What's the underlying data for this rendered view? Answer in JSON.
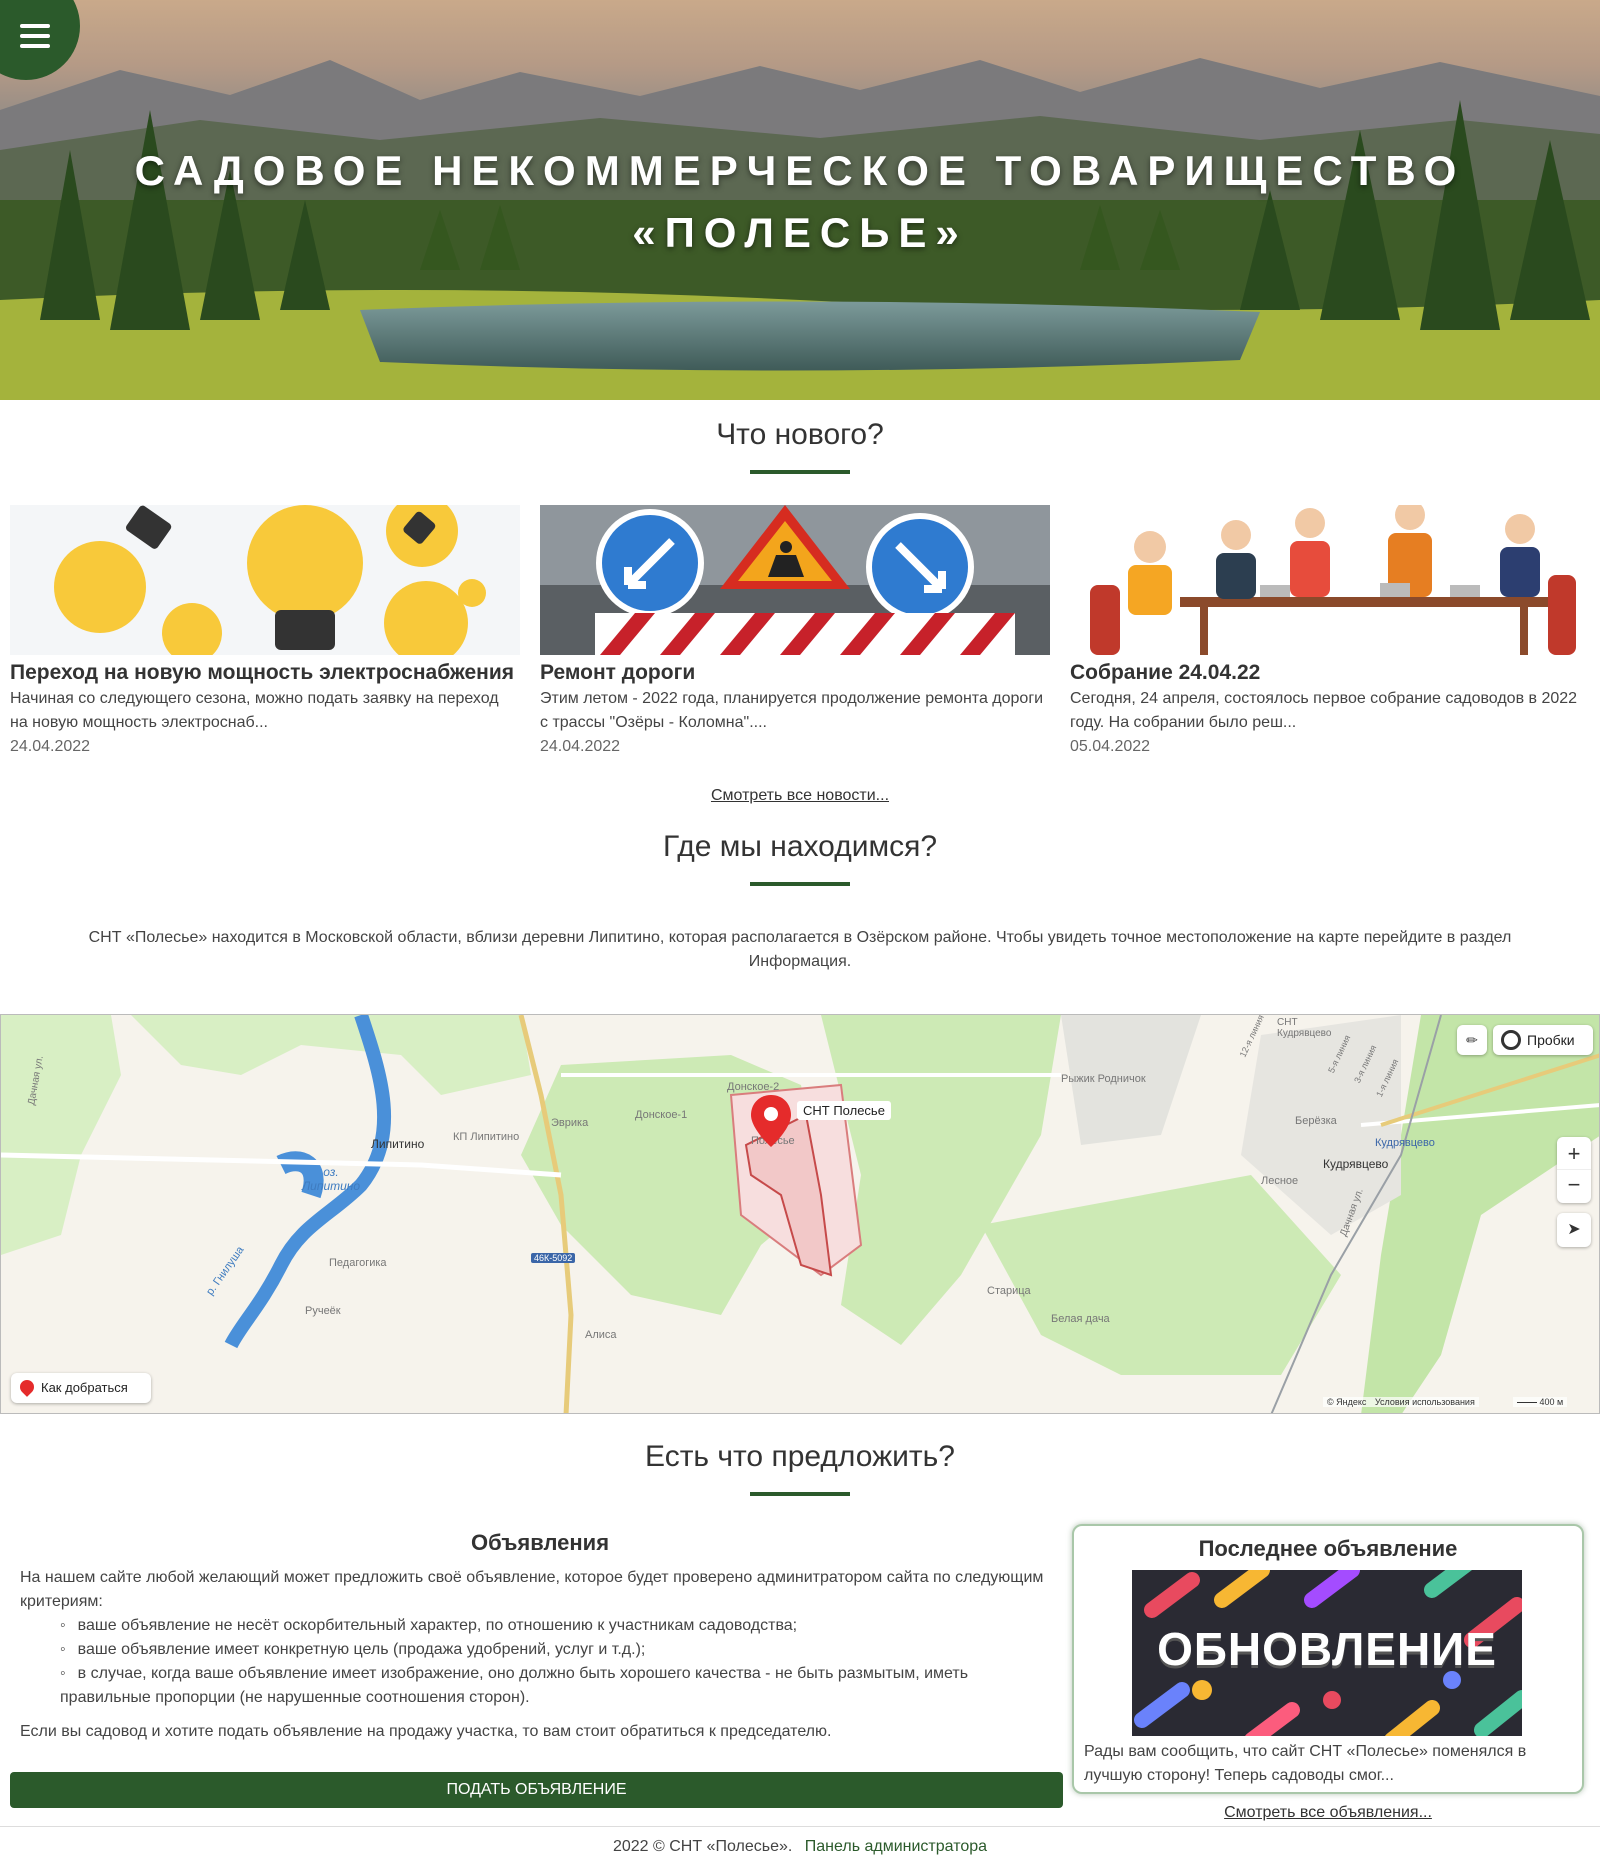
{
  "hero": {
    "title_line1": "САДОВОЕ НЕКОММЕРЧЕСКОЕ ТОВАРИЩЕСТВО",
    "title_line2": "«ПОЛЕСЬЕ»"
  },
  "news": {
    "heading": "Что нового?",
    "items": [
      {
        "title": "Переход на новую мощность электроснабжения",
        "text": "Начиная со следующего сезона, можно подать заявку на переход на новую мощность электроснаб...",
        "date": "24.04.2022"
      },
      {
        "title": "Ремонт дороги",
        "text": "Этим летом - 2022 года, планируется продолжение ремонта дороги с трассы \"Озёры - Коломна\"....",
        "date": "24.04.2022"
      },
      {
        "title": "Собрание 24.04.22",
        "text": "Сегодня, 24 апреля, состоялось первое собрание садоводов в 2022 году. На собрании было реш...",
        "date": "05.04.2022"
      }
    ],
    "all_link": "Смотреть все новости..."
  },
  "location": {
    "heading": "Где мы находимся?",
    "text": "СНТ «Полесье» находится в Московской области, вблизи деревни Липитино, которая располагается в Озёрском районе. Чтобы увидеть точное местоположение на карте перейдите в раздел Информация."
  },
  "map": {
    "marker_label": "СНТ Полесье",
    "traffic_label": "Пробки",
    "route_label": "Как добраться",
    "copyright": "© Яндекс",
    "terms": "Условия использования",
    "scale": "400 м",
    "places": {
      "lipitino": "Липитино",
      "kp_lipitino": "КП Липитино",
      "lake": "оз. Липитино",
      "eureka": "Эврика",
      "donskoe1": "Донское-1",
      "donskoe2": "Донское-2",
      "polesye": "Полесье",
      "pedagogika": "Педагогика",
      "ruchek": "Ручеёк",
      "alisa": "Алиса",
      "road": "46К-5092",
      "river": "р. Гнилуша",
      "dachnaya1": "Дачная ул.",
      "rodnichok": "Рыжик Родничок",
      "snt_kudr": "СНТ Кудрявцево",
      "berezka": "Берёзка",
      "kudr_station": "Кудрявцево",
      "kudryavtsevo": "Кудрявцево",
      "lesnoe": "Лесное",
      "dachnaya2": "Дачная ул.",
      "staritsa": "Старица",
      "belaya_dacha": "Белая дача",
      "line12": "12-я линия",
      "line5": "5-я линия",
      "line3": "3-я линия",
      "line1": "1-я линия"
    }
  },
  "offer": {
    "heading": "Есть что предложить?",
    "ads_title": "Объявления",
    "ads_intro": "На нашем сайте любой желающий может предложить своё объявление, которое будет проверено админитратором сайта по следующим критериям:",
    "criteria": [
      "ваше объявление не несёт оскорбительный характер, по отношению к участникам садоводства;",
      "ваше объявление имеет конкретную цель (продажа удобрений, услуг и т.д.);",
      "в случае, когда ваше объявление имеет изображение, оно должно быть хорошего качества - не быть размытым, иметь правильные пропорции (не нарушенные соотношения сторон)."
    ],
    "ads_note": "Если вы садовод и хотите подать объявление на продажу участка, то вам стоит обратиться к председателю.",
    "submit_label": "ПОДАТЬ ОБЪЯВЛЕНИЕ",
    "last_ad_title": "Последнее объявление",
    "last_ad_image_text": "ОБНОВЛЕНИЕ",
    "last_ad_text": "Рады вам сообщить, что сайт СНТ «Полесье» поменялся в лучшую сторону! Теперь садоводы смог...",
    "all_ads_link": "Смотреть все объявления..."
  },
  "footer": {
    "copyright": "2022 © СНТ «Полесье».",
    "admin_link": "Панель администратора"
  },
  "colors": {
    "accent": "#2b5a2b",
    "marker": "#e52b2b"
  }
}
